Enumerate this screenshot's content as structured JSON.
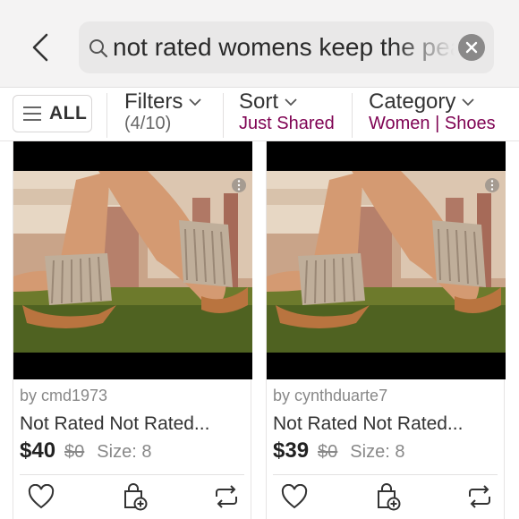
{
  "search": {
    "query": "not rated womens keep the peace"
  },
  "filters": {
    "all_label": "ALL",
    "filters_label": "Filters",
    "filters_count": "(4/10)",
    "sort_label": "Sort",
    "sort_value": "Just Shared",
    "category_label": "Category",
    "category_value": "Women | Shoes"
  },
  "listings": [
    {
      "seller": "by cmd1973",
      "title": "Not Rated Not Rated...",
      "price": "$40",
      "original_price": "$0",
      "size": "Size: 8"
    },
    {
      "seller": "by cynthduarte7",
      "title": "Not Rated Not Rated...",
      "price": "$39",
      "original_price": "$0",
      "size": "Size: 8"
    }
  ],
  "colors": {
    "accent": "#7f0353",
    "header_bg": "#f4f3f3",
    "search_bg": "#e9e8e8"
  },
  "icons": [
    "back-chevron-icon",
    "search-icon",
    "clear-icon",
    "menu-icon",
    "chevron-down-icon",
    "more-icon",
    "heart-icon",
    "bundle-bag-icon",
    "share-icon"
  ]
}
